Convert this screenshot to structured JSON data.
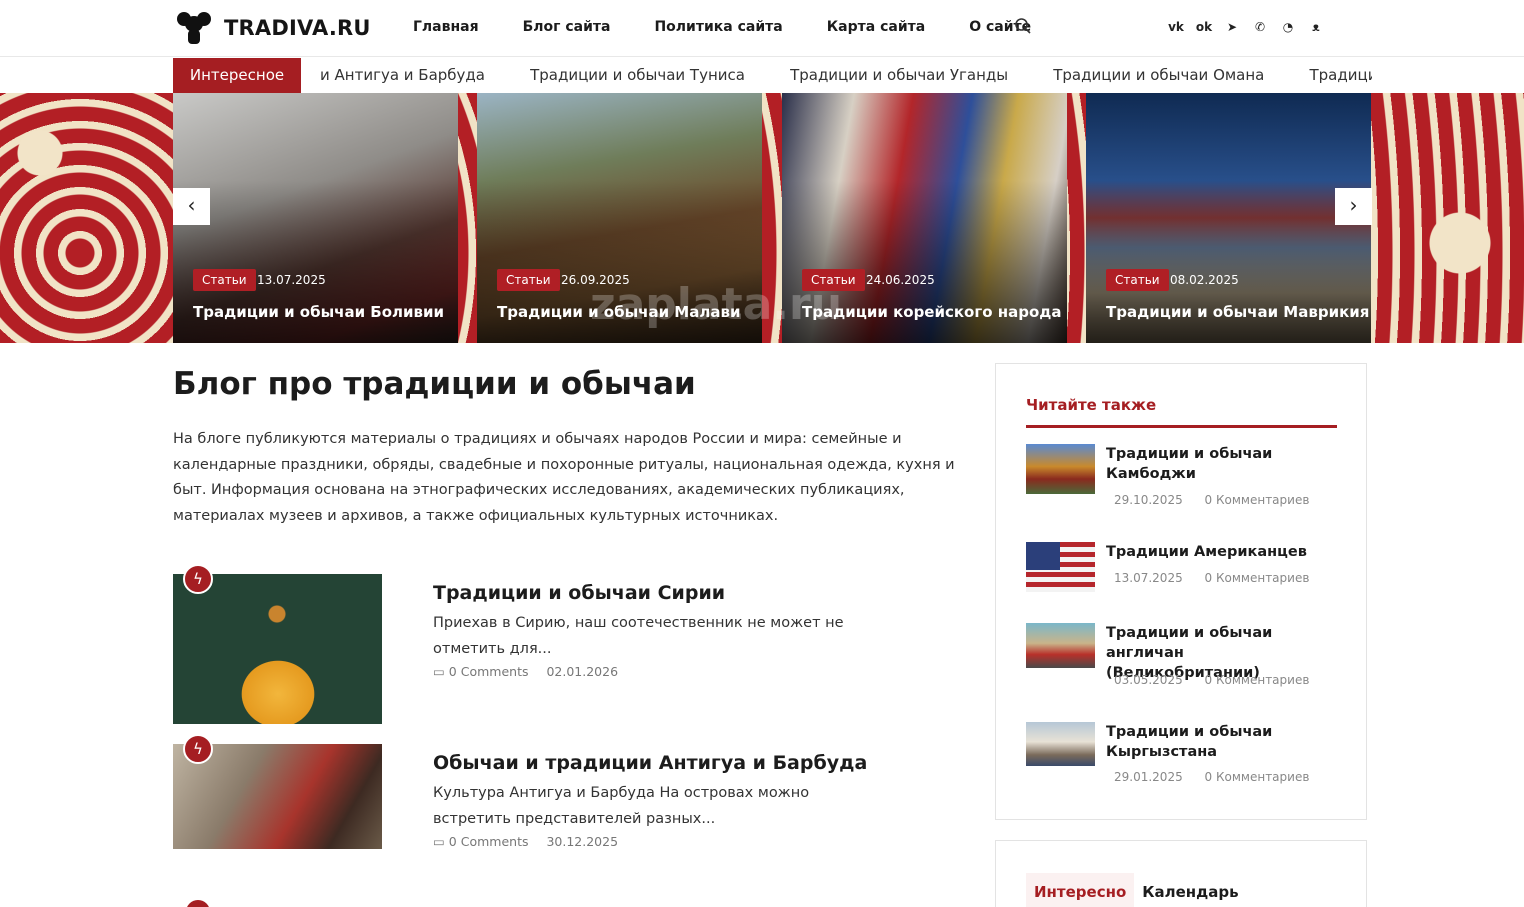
{
  "header": {
    "logo_text": "TRADIVA.RU",
    "nav": [
      "Главная",
      "Блог сайта",
      "Политика сайта",
      "Карта сайта",
      "О сайте"
    ],
    "socials": [
      "vk-icon",
      "ok-icon",
      "telegram-icon",
      "viber-icon",
      "whatsapp-icon",
      "max-icon"
    ]
  },
  "ticker": {
    "label": "Интересное",
    "items": [
      "и Антигуа и Барбуда",
      "Традиции и обычаи Туниса",
      "Традиции и обычаи Уганды",
      "Традиции и обычаи Омана",
      "Традиции и обычаи"
    ]
  },
  "slider": {
    "prev": "‹",
    "next": "›",
    "slides": [
      {
        "badge": "Статьи",
        "date": "13.07.2025",
        "title": "Традиции и обычаи Боливии"
      },
      {
        "badge": "Статьи",
        "date": "26.09.2025",
        "title": "Традиции и обычаи Малави"
      },
      {
        "badge": "Статьи",
        "date": "24.06.2025",
        "title": "Традиции корейского народа"
      },
      {
        "badge": "Статьи",
        "date": "08.02.2025",
        "title": "Традиции и обычаи Маврикия"
      }
    ],
    "watermark": "zaplata.ru"
  },
  "main": {
    "title": "Блог про традиции и обычаи",
    "intro": "На блоге публикуются материалы о традициях и обычаях народов России и мира: семейные и календарные праздники, обряды, свадебные и похоронные ритуалы, национальная одежда, кухня и быт. Информация основана на этнографических исследованиях, академических публикациях, материалах музеев и архивов, а также официальных культурных источниках.",
    "posts": [
      {
        "title": "Традиции и обычаи Сирии",
        "excerpt": "Приехав в Сирию, наш соотечественник не может не отметить для...",
        "comments": "0 Comments",
        "date": "02.01.2026"
      },
      {
        "title": "Обычаи и традиции Антигуа и Барбуда",
        "excerpt": "Культура Антигуа и Барбуда На островах можно встретить представителей разных...",
        "comments": "0 Comments",
        "date": "30.12.2025"
      }
    ]
  },
  "sidebar": {
    "heading": "Читайте также",
    "items": [
      {
        "title": "Традиции и обычаи Камбоджи",
        "date": "29.10.2025",
        "comments": "0 Комментариев"
      },
      {
        "title": "Традиции Американцев",
        "date": "13.07.2025",
        "comments": "0 Комментариев"
      },
      {
        "title": "Традиции и обычаи англичан (Великобритании)",
        "date": "03.05.2025",
        "comments": "0 Комментариев"
      },
      {
        "title": "Традиции и обычаи Кыргызстана",
        "date": "29.01.2025",
        "comments": "0 Комментариев"
      }
    ],
    "tabs": [
      "Интересно",
      "Календарь"
    ]
  },
  "colors": {
    "accent": "#a51e22",
    "ornament_red": "#b31f25",
    "ornament_cream": "#f1e3c6"
  }
}
